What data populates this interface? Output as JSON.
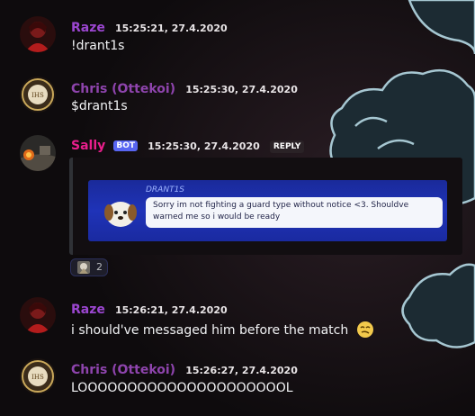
{
  "messages": [
    {
      "author": "Raze",
      "time": "15:25:21, 27.4.2020",
      "text": "!drant1s",
      "color": "#9b46d0"
    },
    {
      "author": "Chris (Ottekoi)",
      "time": "15:25:30, 27.4.2020",
      "text": "$drant1s",
      "color": "#8e44ad"
    },
    {
      "author": "Sally",
      "bot_tag": "BOT",
      "time": "15:25:30, 27.4.2020",
      "reply_label": "REPLY",
      "color": "#e91e8c",
      "embed": {
        "name": "DRANT1S",
        "text": "Sorry im not fighting a guard type without notice <3. Shouldve warned me so i would be ready"
      },
      "reaction": {
        "count": "2"
      }
    },
    {
      "author": "Raze",
      "time": "15:26:21, 27.4.2020",
      "text": "i should've messaged him before the match",
      "color": "#9b46d0"
    },
    {
      "author": "Chris (Ottekoi)",
      "time": "15:26:27, 27.4.2020",
      "text": "LOOOOOOOOOOOOOOOOOOOOOL",
      "color": "#8e44ad"
    }
  ],
  "avatars": {
    "raze": "raze-avatar",
    "chris": "ihs-seal-avatar",
    "sally": "sally-avatar"
  },
  "colors": {
    "background": "#0e0b0d",
    "cloud": "#a6c7d2",
    "bot": "#5865f2"
  }
}
